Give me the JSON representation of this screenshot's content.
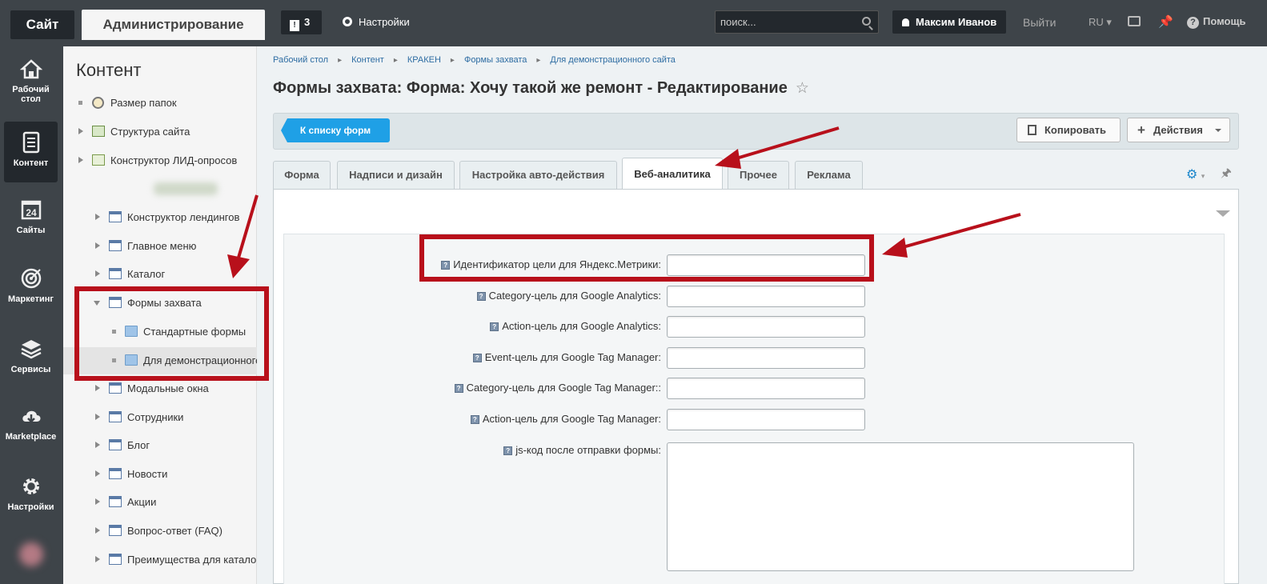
{
  "topbar": {
    "site": "Сайт",
    "admin": "Администрирование",
    "notifications": "3",
    "settings": "Настройки",
    "search_placeholder": "поиск...",
    "user": "Максим Иванов",
    "logout": "Выйти",
    "lang": "RU",
    "help": "Помощь"
  },
  "leftmenu": [
    {
      "label": "Рабочий стол",
      "icon": "home-icon"
    },
    {
      "label": "Контент",
      "icon": "document-icon",
      "active": true
    },
    {
      "label": "Сайты",
      "icon": "calendar-24-icon"
    },
    {
      "label": "Маркетинг",
      "icon": "target-icon"
    },
    {
      "label": "Сервисы",
      "icon": "layers-icon"
    },
    {
      "label": "Marketplace",
      "icon": "cloud-download-icon"
    },
    {
      "label": "Настройки",
      "icon": "gear-icon"
    }
  ],
  "tree": {
    "title": "Контент",
    "items": [
      {
        "label": "Размер папок"
      },
      {
        "label": "Структура сайта"
      },
      {
        "label": "Конструктор ЛИД-опросов"
      },
      {
        "label": "Конструктор лендингов"
      },
      {
        "label": "Главное меню"
      },
      {
        "label": "Каталог"
      },
      {
        "label": "Формы захвата"
      },
      {
        "label": "Стандартные формы"
      },
      {
        "label": "Для демонстрационного сайта"
      },
      {
        "label": "Модальные окна"
      },
      {
        "label": "Сотрудники"
      },
      {
        "label": "Блог"
      },
      {
        "label": "Новости"
      },
      {
        "label": "Акции"
      },
      {
        "label": "Вопрос-ответ (FAQ)"
      },
      {
        "label": "Преимущества для каталога"
      }
    ]
  },
  "breadcrumbs": [
    "Рабочий стол",
    "Контент",
    "КРАКЕН",
    "Формы захвата",
    "Для демонстрационного сайта"
  ],
  "page_title": "Формы захвата: Форма: Хочу такой же ремонт - Редактирование",
  "toolbar": {
    "back": "К списку форм",
    "copy": "Копировать",
    "actions": "Действия"
  },
  "tabs": [
    {
      "label": "Форма"
    },
    {
      "label": "Надписи и дизайн"
    },
    {
      "label": "Настройка авто-действия"
    },
    {
      "label": "Веб-аналитика",
      "active": true
    },
    {
      "label": "Прочее"
    },
    {
      "label": "Реклама"
    }
  ],
  "fields": [
    {
      "label": "Идентификатор цели для Яндекс.Метрики:",
      "value": ""
    },
    {
      "label": "Category-цель для Google Analytics:",
      "value": ""
    },
    {
      "label": "Action-цель для Google Analytics:",
      "value": ""
    },
    {
      "label": "Event-цель для Google Tag Manager:",
      "value": ""
    },
    {
      "label": "Category-цель для Google Tag Manager::",
      "value": ""
    },
    {
      "label": "Action-цель для Google Tag Manager:",
      "value": ""
    },
    {
      "label": "js-код после отправки формы:",
      "value": ""
    }
  ],
  "colors": {
    "annotation": "#b8101b",
    "accent": "#1fa0e6",
    "topbar": "#3e4449"
  }
}
